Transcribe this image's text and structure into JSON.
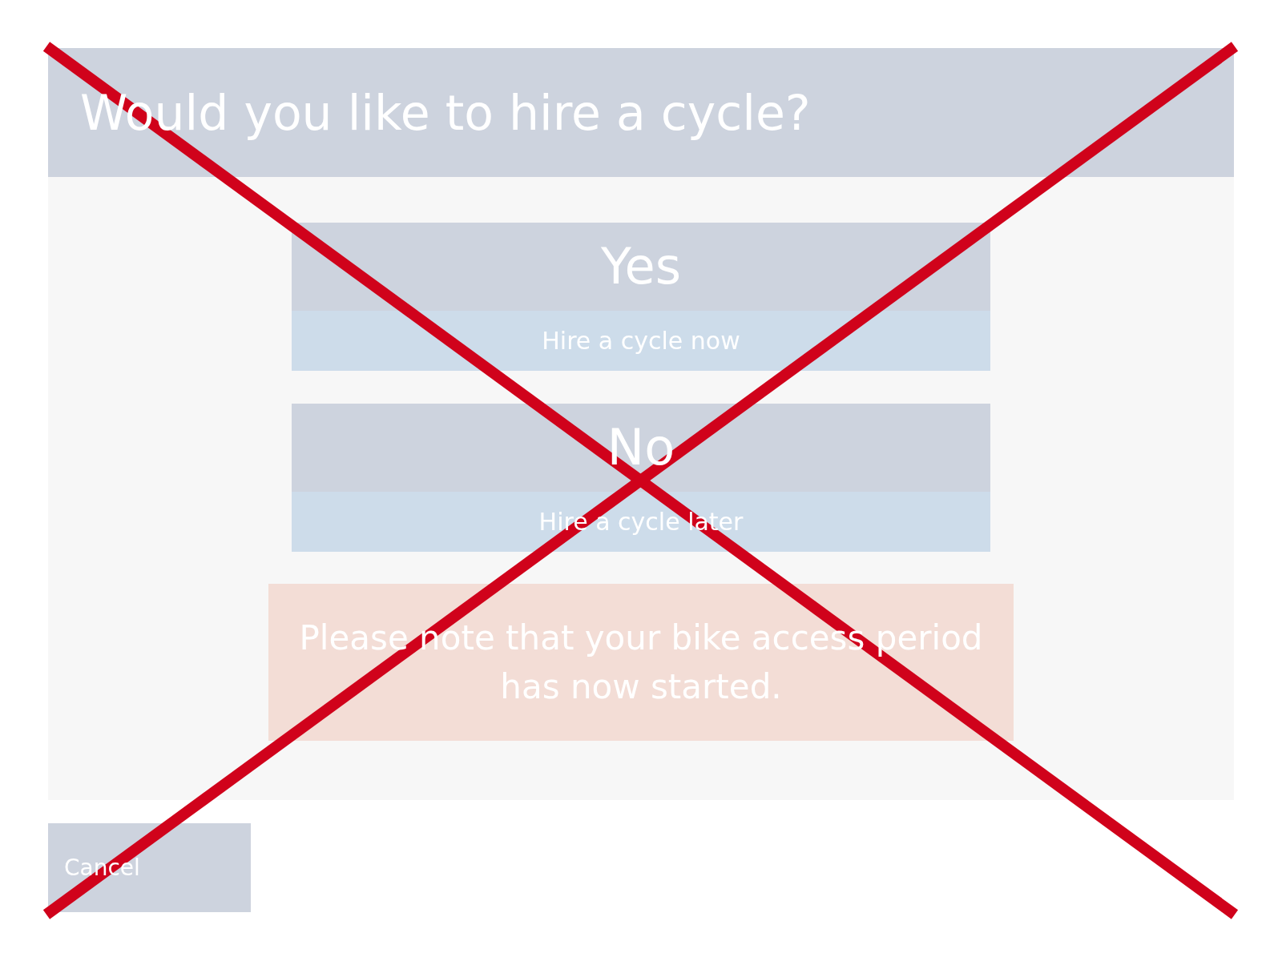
{
  "dialog": {
    "title": "Would you like to hire a cycle?"
  },
  "options": [
    {
      "label": "Yes",
      "description": "Hire a cycle now"
    },
    {
      "label": "No",
      "description": "Hire a cycle later"
    }
  ],
  "notice": "Please note that your bike access period has now started.",
  "buttons": [
    {
      "label": "Cancel"
    }
  ],
  "crossed_out": true
}
